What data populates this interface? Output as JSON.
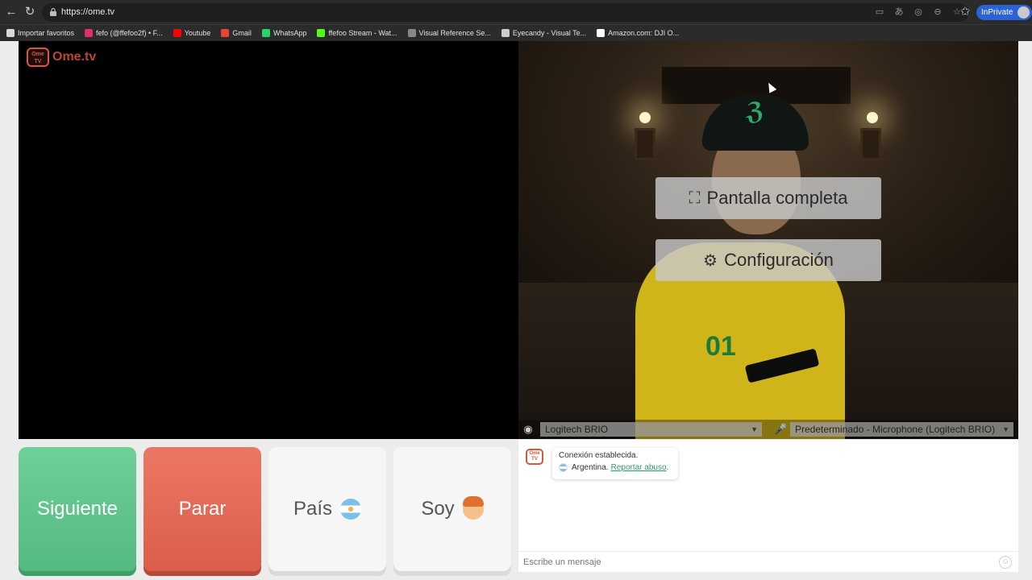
{
  "browser": {
    "url": "https://ome.tv",
    "inprivate_label": "InPrivate",
    "bookmarks": [
      {
        "label": "Importar favoritos",
        "icon": "folder-icon",
        "color": "#d8d8d8"
      },
      {
        "label": "fefo (@ffefoo2f) • F...",
        "icon": "instagram-icon",
        "color": "#e1306c"
      },
      {
        "label": "Youtube",
        "icon": "youtube-icon",
        "color": "#ff0000"
      },
      {
        "label": "Gmail",
        "icon": "gmail-icon",
        "color": "#ea4335"
      },
      {
        "label": "WhatsApp",
        "icon": "whatsapp-icon",
        "color": "#25d366"
      },
      {
        "label": "ffefoo Stream - Wat...",
        "icon": "kick-icon",
        "color": "#53fc18"
      },
      {
        "label": "Visual Reference Se...",
        "icon": "globe-icon",
        "color": "#888888"
      },
      {
        "label": "Eyecandy - Visual Te...",
        "icon": "eyecandy-icon",
        "color": "#cccccc"
      },
      {
        "label": "Amazon.com: DJI O...",
        "icon": "amazon-icon",
        "color": "#ffffff"
      }
    ]
  },
  "site": {
    "logo_small": "Ome TV",
    "logo_word": "Ome.tv"
  },
  "overlay": {
    "fullscreen_label": "Pantalla completa",
    "settings_label": "Configuración"
  },
  "devices": {
    "camera": "Logitech BRIO",
    "microphone": "Predeterminado - Microphone (Logitech BRIO)"
  },
  "controls": {
    "next": "Siguiente",
    "stop": "Parar",
    "country": "País",
    "me": "Soy"
  },
  "chat": {
    "status": "Conexión establecida.",
    "country": "Argentina.",
    "report": "Reportar abuso",
    "report_suffix": ".",
    "placeholder": "Escribe un mensaje"
  },
  "colors": {
    "next": "#5fc28d",
    "stop": "#e36a57",
    "brand": "#d9563a"
  }
}
